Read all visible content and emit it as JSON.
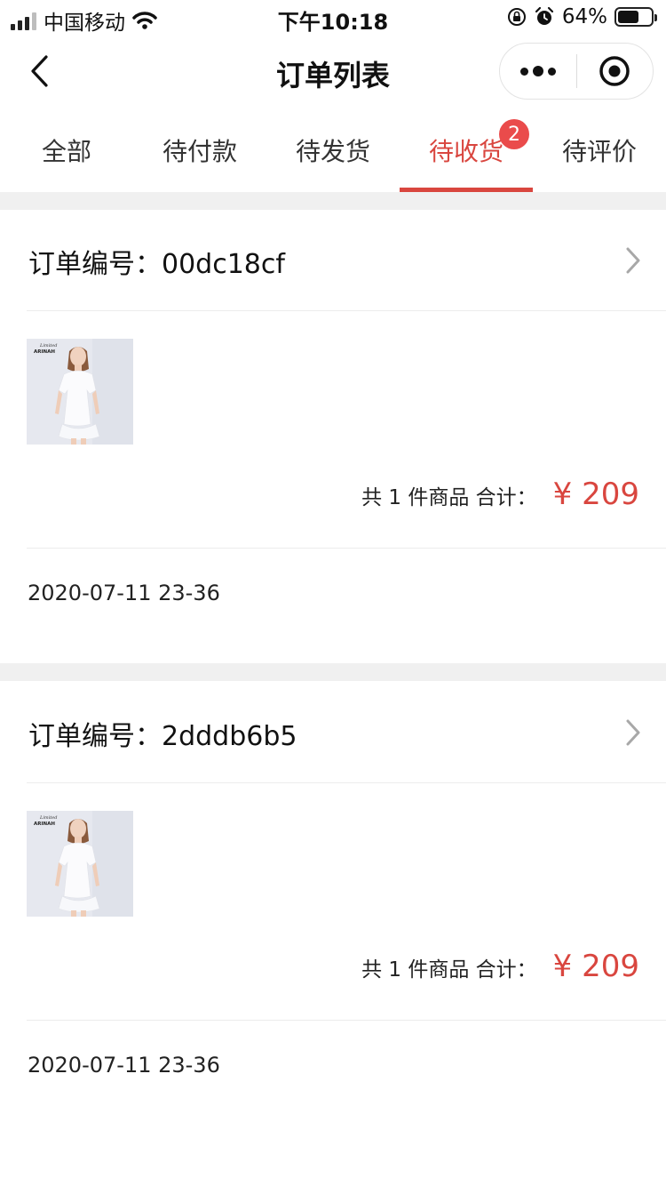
{
  "status_bar": {
    "carrier": "中国移动",
    "time": "下午10:18",
    "battery_percent": "64%",
    "battery_level": 0.64
  },
  "nav": {
    "title": "订单列表",
    "back_icon": "chevron-left-icon",
    "more_icon": "more-dots-icon",
    "close_icon": "target-circle-icon"
  },
  "tabs": [
    {
      "label": "全部"
    },
    {
      "label": "待付款"
    },
    {
      "label": "待发货"
    },
    {
      "label": "待收货",
      "active": true,
      "badge": "2"
    },
    {
      "label": "待评价"
    }
  ],
  "orders": [
    {
      "label": "订单编号：",
      "number": "00dc18cf",
      "item_count": "共 1 件商品 合计：",
      "price": "¥ 209",
      "date": "2020-07-11 23-36",
      "thumb_brand": "ARINAH"
    },
    {
      "label": "订单编号：",
      "number": "2dddb6b5",
      "item_count": "共 1 件商品 合计：",
      "price": "¥ 209",
      "date": "2020-07-11 23-36",
      "thumb_brand": "ARINAH"
    }
  ],
  "colors": {
    "accent": "#d9463f",
    "badge": "#ea4b4b",
    "separator": "#f0f0f0"
  }
}
